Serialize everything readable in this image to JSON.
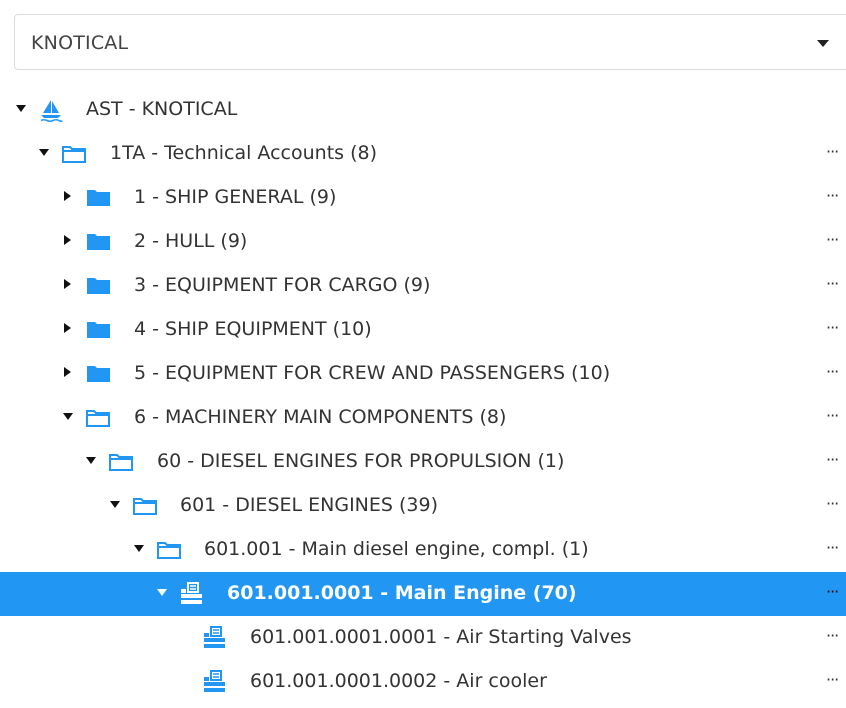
{
  "dropdown": {
    "value": "KNOTICAL"
  },
  "tree": {
    "more_label": "···",
    "rows": [
      {
        "label": "AST - KNOTICAL",
        "icon": "sailboat-icon",
        "toggle": "expanded"
      },
      {
        "label": "1TA - Technical Accounts (8)",
        "icon": "folder-outline-icon",
        "toggle": "expanded"
      },
      {
        "label": "1 - SHIP GENERAL (9)",
        "icon": "folder-filled-icon",
        "toggle": "collapsed"
      },
      {
        "label": "2 - HULL (9)",
        "icon": "folder-filled-icon",
        "toggle": "collapsed"
      },
      {
        "label": "3 - EQUIPMENT FOR CARGO (9)",
        "icon": "folder-filled-icon",
        "toggle": "collapsed"
      },
      {
        "label": "4 - SHIP EQUIPMENT (10)",
        "icon": "folder-filled-icon",
        "toggle": "collapsed"
      },
      {
        "label": "5 - EQUIPMENT FOR CREW AND PASSENGERS (10)",
        "icon": "folder-filled-icon",
        "toggle": "collapsed"
      },
      {
        "label": "6 - MACHINERY MAIN COMPONENTS (8)",
        "icon": "folder-outline-icon",
        "toggle": "expanded"
      },
      {
        "label": "60 - DIESEL ENGINES FOR PROPULSION (1)",
        "icon": "folder-outline-icon",
        "toggle": "expanded"
      },
      {
        "label": "601 - DIESEL ENGINES (39)",
        "icon": "folder-outline-icon",
        "toggle": "expanded"
      },
      {
        "label": "601.001 - Main diesel engine, compl. (1)",
        "icon": "folder-outline-icon",
        "toggle": "expanded"
      },
      {
        "label": "601.001.0001 - Main Engine (70)",
        "icon": "component-icon",
        "toggle": "expanded",
        "selected": true
      },
      {
        "label": "601.001.0001.0001 - Air Starting Valves",
        "icon": "component-icon",
        "toggle": "none"
      },
      {
        "label": "601.001.0001.0002 - Air cooler",
        "icon": "component-icon",
        "toggle": "none"
      }
    ]
  },
  "colors": {
    "accent": "#2196f3",
    "folder": "#2196f3",
    "text": "#333333"
  }
}
